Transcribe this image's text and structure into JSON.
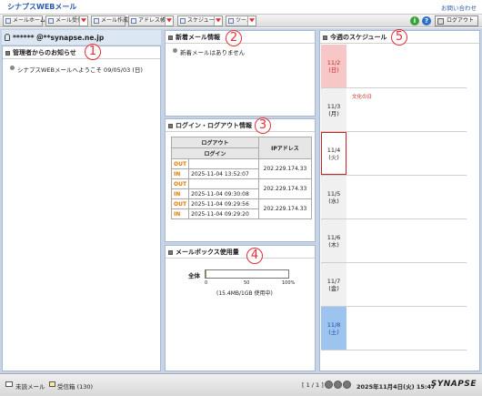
{
  "app": {
    "title": "シナプスWEBメール",
    "contact": "お問い合わせ"
  },
  "toolbar": {
    "mail_home": "メールホーム",
    "mail_send": "メール受信",
    "mail_compose": "メール作成",
    "address_book": "アドレス帳",
    "schedule": "スケジューラ",
    "tools": "ツール",
    "logout": "ログアウト"
  },
  "user": {
    "email": "****** ＠**synapse.ne.jp"
  },
  "notices": {
    "title": "管理者からのお知らせ",
    "items": [
      "シナプスWEBメールへようこそ 09/05/03 (日)"
    ]
  },
  "new_mail": {
    "title": "新着メール情報",
    "empty_text": "新着メールはありません"
  },
  "login_info": {
    "title": "ログイン・ログアウト情報",
    "headers": {
      "logout": "ログアウト",
      "login": "ログイン",
      "ip": "IPアドレス"
    },
    "rows": [
      {
        "out_label": "OUT",
        "out_time": "",
        "in_label": "IN",
        "in_time": "2025-11-04 13:52:07",
        "ip": "202.229.174.33"
      },
      {
        "out_label": "OUT",
        "out_time": "",
        "in_label": "IN",
        "in_time": "2025-11-04 09:30:08",
        "ip": "202.229.174.33"
      },
      {
        "out_label": "OUT",
        "out_time": "2025-11-04 09:29:56",
        "in_label": "IN",
        "in_time": "2025-11-04 09:29:20",
        "ip": "202.229.174.33"
      }
    ]
  },
  "mailbox": {
    "title": "メールボックス使用量",
    "label": "全体",
    "usage_percent": 0.5,
    "ticks": [
      "0",
      "50",
      "100%"
    ],
    "caption": "(15.4MB/1GB 使用中)"
  },
  "schedule": {
    "title": "今週のスケジュール",
    "days": [
      {
        "date": "11/2",
        "weekday": "(日)",
        "type": "sunday",
        "event": ""
      },
      {
        "date": "11/3",
        "weekday": "(月)",
        "type": "weekday",
        "event": "文化の日"
      },
      {
        "date": "11/4",
        "weekday": "(火)",
        "type": "today",
        "event": ""
      },
      {
        "date": "11/5",
        "weekday": "(水)",
        "type": "weekday",
        "event": ""
      },
      {
        "date": "11/6",
        "weekday": "(木)",
        "type": "weekday",
        "event": ""
      },
      {
        "date": "11/7",
        "weekday": "(金)",
        "type": "weekday",
        "event": ""
      },
      {
        "date": "11/8",
        "weekday": "(土)",
        "type": "saturday",
        "event": ""
      }
    ]
  },
  "annotations": [
    "1",
    "2",
    "3",
    "4",
    "5"
  ],
  "status": {
    "unread_label": "未読メール",
    "inbox_label": "受信箱 (130)",
    "pager": "[ 1 / 1 ]",
    "datetime": "2025年11月4日(火) 15:47",
    "brand": "SYNAPSE"
  },
  "colors": {
    "accent": "#2b5aa8",
    "frame": "#c6d3e5",
    "sunday": "#f7c7c8",
    "saturday": "#9dc4ee",
    "today_border": "#cc2222",
    "annotation": "#e0303a"
  }
}
